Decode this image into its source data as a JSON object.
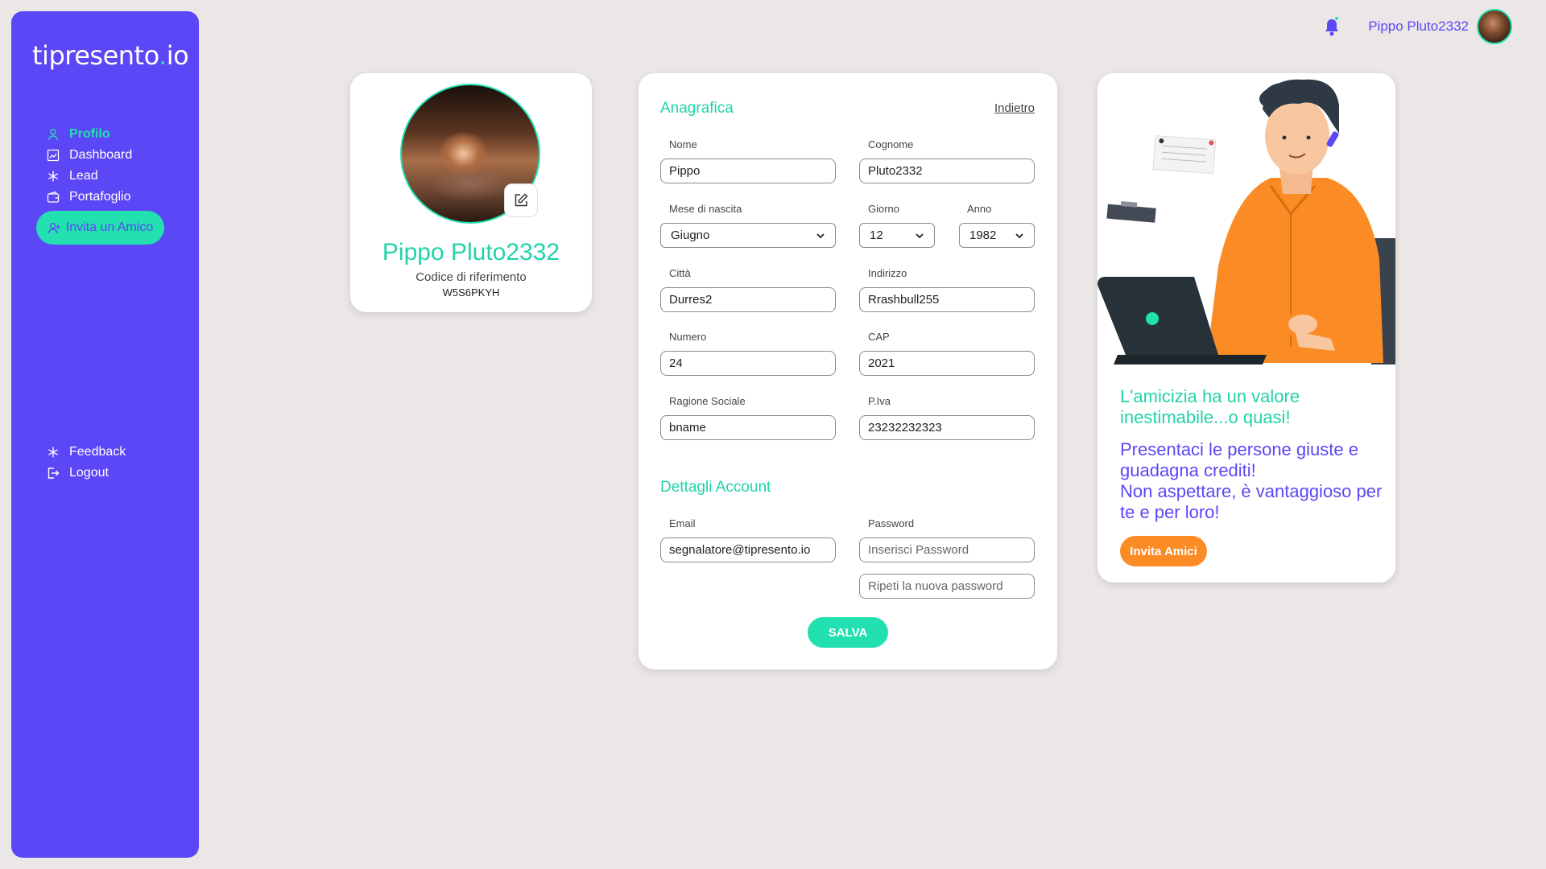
{
  "brand": {
    "logo_main": "tipresento",
    "logo_dot": ".",
    "logo_suffix": "io"
  },
  "sidebar": {
    "items": [
      {
        "label": "Profilo",
        "icon": "user-icon",
        "active": true
      },
      {
        "label": "Dashboard",
        "icon": "chart-icon"
      },
      {
        "label": "Lead",
        "icon": "asterisk-icon"
      },
      {
        "label": "Portafoglio",
        "icon": "wallet-icon"
      }
    ],
    "invite_label": "Invita un Amico",
    "bottom_items": [
      {
        "label": "Feedback",
        "icon": "asterisk-icon"
      },
      {
        "label": "Logout",
        "icon": "logout-icon"
      }
    ]
  },
  "topbar": {
    "user_name": "Pippo Pluto2332"
  },
  "profile": {
    "name": "Pippo Pluto2332",
    "ref_label": "Codice di riferimento",
    "ref_code": "W5S6PKYH"
  },
  "form": {
    "anagrafica_title": "Anagrafica",
    "back_label": "Indietro",
    "nome_label": "Nome",
    "nome_value": "Pippo",
    "cognome_label": "Cognome",
    "cognome_value": "Pluto2332",
    "mese_label": "Mese di nascita",
    "mese_value": "Giugno",
    "giorno_label": "Giorno",
    "giorno_value": "12",
    "anno_label": "Anno",
    "anno_value": "1982",
    "citta_label": "Città",
    "citta_value": "Durres2",
    "indirizzo_label": "Indirizzo",
    "indirizzo_value": "Rrashbull255",
    "numero_label": "Numero",
    "numero_value": "24",
    "cap_label": "CAP",
    "cap_value": "2021",
    "ragione_label": "Ragione Sociale",
    "ragione_value": "bname",
    "piva_label": "P.Iva",
    "piva_value": "23232232323",
    "account_title": "Dettagli Account",
    "email_label": "Email",
    "email_value": "segnalatore@tipresento.io",
    "password_label": "Password",
    "password_placeholder": "Inserisci Password",
    "password_repeat_placeholder": "Ripeti la nuova password",
    "save_label": "SALVA"
  },
  "promo": {
    "line1": "L'amicizia ha un valore inestimabile...o quasi!",
    "line2a": "Presentaci le persone giuste e guadagna crediti!",
    "line2b": "Non aspettare, è vantaggioso per te e per loro!",
    "button_label": "Invita Amici"
  },
  "colors": {
    "brand_purple": "#5b47f5",
    "brand_teal": "#22e0b0",
    "accent_orange": "#fb8b24",
    "background": "#ece7e7"
  }
}
